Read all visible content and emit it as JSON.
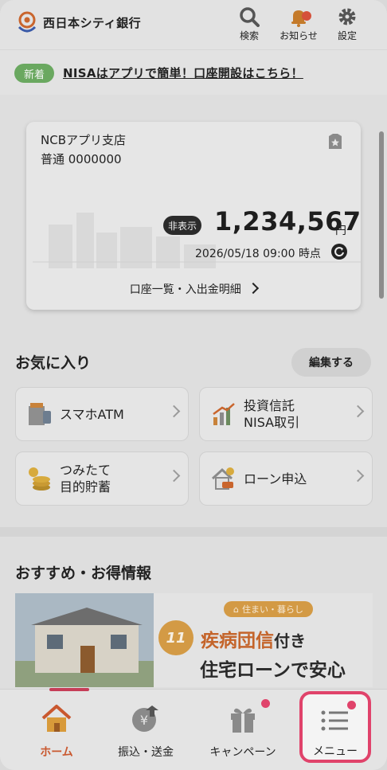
{
  "app": {
    "name": "西日本シティ銀行"
  },
  "header": {
    "search_label": "検索",
    "notifications_label": "お知らせ",
    "settings_label": "設定"
  },
  "news": {
    "badge": "新着",
    "text": "NISAはアプリで簡単！口座開設はこちら！"
  },
  "account": {
    "branch": "NCBアプリ支店",
    "number": "普通 0000000",
    "hide_label": "非表示",
    "balance": "1,234,567",
    "currency": "円",
    "as_of": "2026/05/18 09:00 時点",
    "link_label": "口座一覧・入出金明細"
  },
  "favorites": {
    "title": "お気に入り",
    "edit_label": "編集する",
    "items": [
      {
        "label": "スマホATM",
        "icon": "atm-icon"
      },
      {
        "label": "投資信託\nNISA取引",
        "icon": "investment-chart-icon"
      },
      {
        "label": "つみたて\n目的貯蓄",
        "icon": "coin-stack-icon"
      },
      {
        "label": "ローン申込",
        "icon": "house-loan-icon"
      }
    ]
  },
  "recommend": {
    "title": "おすすめ・お得情報",
    "banner": {
      "tag": "住まい・暮らし",
      "number": "11",
      "line1_main": "疾病団信",
      "line1_suffix": "付き",
      "line2": "住宅ローンで安心"
    }
  },
  "tabbar": {
    "items": [
      {
        "label": "ホーム",
        "icon": "home-icon",
        "active": true
      },
      {
        "label": "振込・送金",
        "icon": "yen-transfer-icon"
      },
      {
        "label": "キャンペーン",
        "icon": "gift-icon"
      },
      {
        "label": "メニュー",
        "icon": "menu-list-icon"
      }
    ]
  },
  "colors": {
    "accent": "#e0436b",
    "new_badge": "#6aa860",
    "home_active": "#d0583a"
  }
}
